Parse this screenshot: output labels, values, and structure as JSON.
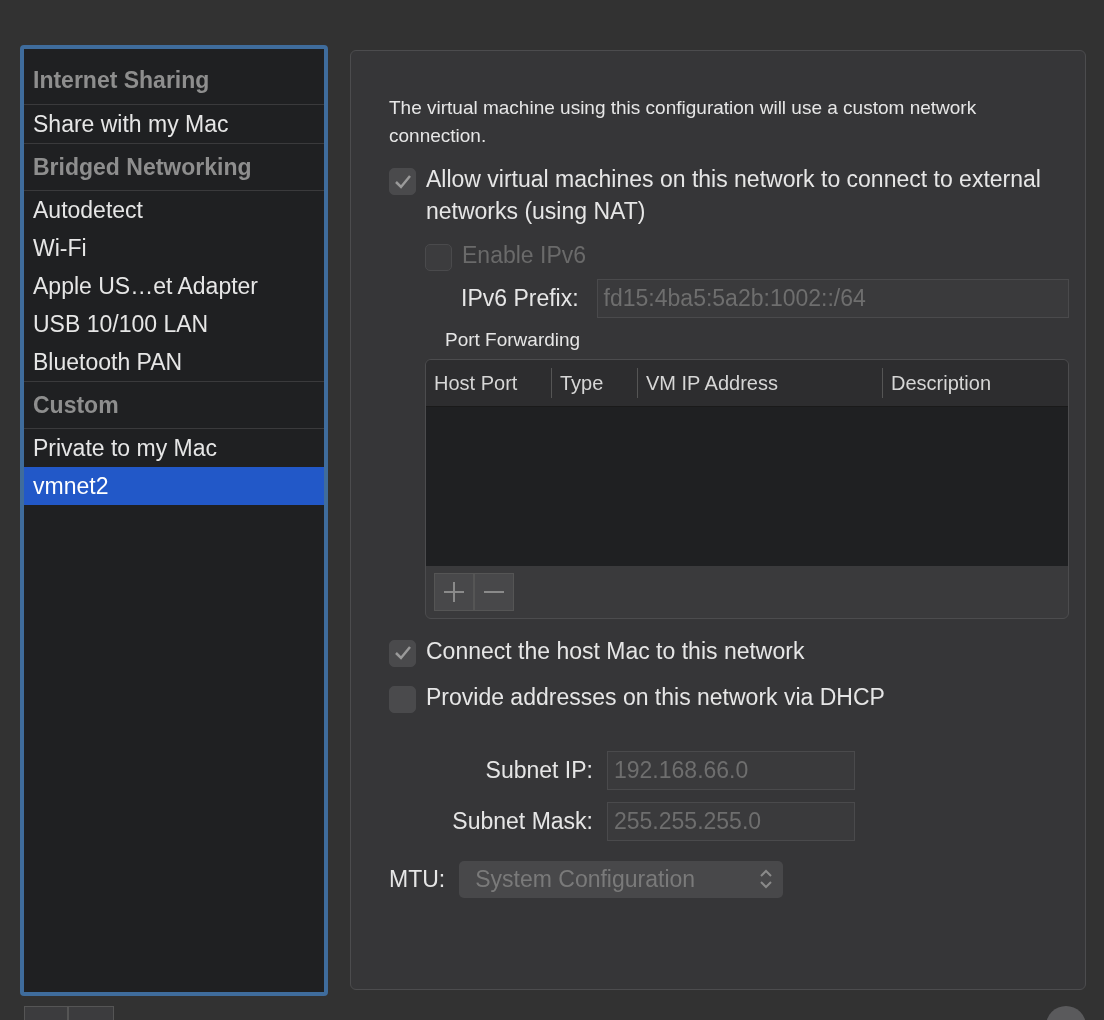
{
  "sidebar": {
    "items": [
      {
        "kind": "header",
        "label": "Internet Sharing",
        "selected": false
      },
      {
        "kind": "item",
        "label": "Share with my Mac",
        "selected": false
      },
      {
        "kind": "header",
        "label": "Bridged Networking",
        "selected": false
      },
      {
        "kind": "item",
        "label": "Autodetect",
        "selected": false
      },
      {
        "kind": "item",
        "label": "Wi-Fi",
        "selected": false
      },
      {
        "kind": "item",
        "label": "Apple US…et Adapter",
        "selected": false
      },
      {
        "kind": "item",
        "label": "USB 10/100 LAN",
        "selected": false
      },
      {
        "kind": "item",
        "label": "Bluetooth PAN",
        "selected": false
      },
      {
        "kind": "header",
        "label": "Custom",
        "selected": false
      },
      {
        "kind": "item",
        "label": "Private to my Mac",
        "selected": false
      },
      {
        "kind": "item",
        "label": "vmnet2",
        "selected": true
      }
    ]
  },
  "panel": {
    "description": "The virtual machine using this configuration will use a custom network connection.",
    "nat": {
      "label": "Allow virtual machines on this network to connect to external networks (using NAT)",
      "checked": true
    },
    "ipv6": {
      "label": "Enable IPv6",
      "checked": false,
      "disabled": true
    },
    "ipv6_prefix": {
      "label": "IPv6 Prefix:",
      "value": "fd15:4ba5:5a2b:1002::/64"
    },
    "port_forwarding": {
      "title": "Port Forwarding",
      "columns": [
        "Host Port",
        "Type",
        "VM IP Address",
        "Description"
      ]
    },
    "connect_host": {
      "label": "Connect the host Mac to this network",
      "checked": true
    },
    "dhcp": {
      "label": "Provide addresses on this network via DHCP",
      "checked": false
    },
    "subnet_ip": {
      "label": "Subnet IP:",
      "value": "192.168.66.0"
    },
    "subnet_mask": {
      "label": "Subnet Mask:",
      "value": "255.255.255.0"
    },
    "mtu": {
      "label": "MTU:",
      "value": "System Configuration"
    }
  }
}
